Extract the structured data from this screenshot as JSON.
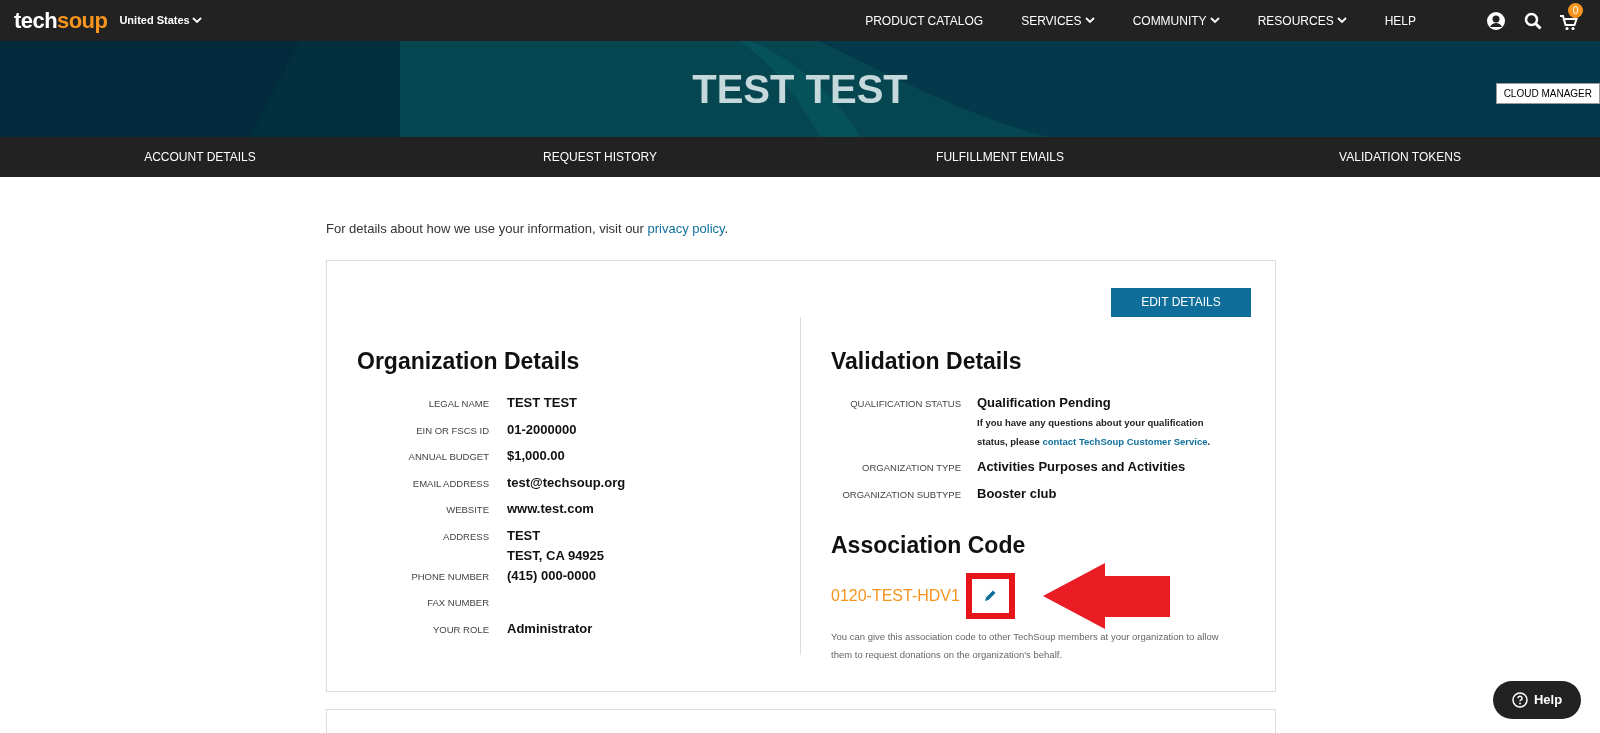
{
  "header": {
    "logo": {
      "part_1": "tech",
      "part_2": "soup"
    },
    "region": "United States",
    "nav": [
      {
        "label": "PRODUCT CATALOG",
        "dropdown": false
      },
      {
        "label": "SERVICES",
        "dropdown": true
      },
      {
        "label": "COMMUNITY",
        "dropdown": true
      },
      {
        "label": "RESOURCES",
        "dropdown": true
      },
      {
        "label": "HELP",
        "dropdown": false
      }
    ],
    "cart_count": "0"
  },
  "banner": {
    "title": "TEST TEST",
    "side_button": "CLOUD MANAGER"
  },
  "tabs": [
    {
      "label": "ACCOUNT DETAILS",
      "selected": false
    },
    {
      "label": "REQUEST HISTORY",
      "selected": false
    },
    {
      "label": "FULFILLMENT EMAILS",
      "selected": false
    },
    {
      "label": "VALIDATION TOKENS",
      "selected": false
    }
  ],
  "privacy_note": {
    "text": "For details about how we use your information, visit our",
    "link": "privacy policy",
    "end": "."
  },
  "edit_button": "EDIT DETAILS",
  "organization": {
    "title": "Organization Details",
    "fields": [
      {
        "label": "LEGAL NAME",
        "value": [
          "TEST TEST"
        ]
      },
      {
        "label": "EIN OR FSCS ID",
        "value": [
          "01-2000000"
        ]
      },
      {
        "label": "ANNUAL BUDGET",
        "value": [
          "$1,000.00"
        ]
      },
      {
        "label": "EMAIL ADDRESS",
        "value": [
          "test@techsoup.org"
        ]
      },
      {
        "label": "WEBSITE",
        "value": [
          "www.test.com"
        ]
      },
      {
        "label": "ADDRESS",
        "value": [
          "TEST",
          "TEST, CA 94925"
        ]
      },
      {
        "label": "PHONE NUMBER",
        "value": [
          "(415) 000-0000"
        ]
      },
      {
        "label": "FAX NUMBER"
      },
      {
        "label": "YOUR ROLE",
        "value": [
          "Administrator"
        ]
      }
    ]
  },
  "validation": {
    "title": "Validation Details",
    "fields": [
      {
        "label": "QUALIFICATION STATUS",
        "value": "Qualification Pending",
        "note": {
          "text": "If you have any questions about your qualification status, please",
          "link": "contact TechSoup Customer Service",
          "end": "."
        }
      },
      {
        "label": "ORGANIZATION TYPE",
        "value": "Activities Purposes and Activities"
      },
      {
        "label": "ORGANIZATION SUBTYPE",
        "value": "Booster club"
      }
    ]
  },
  "association": {
    "title": "Association Code",
    "code": "0120-TEST-HDV1",
    "description": "You can give this association code to other TechSoup members at your organization to allow them to request donations on the organization's behalf."
  },
  "help_button": "Help"
}
